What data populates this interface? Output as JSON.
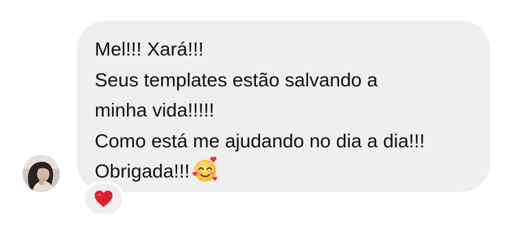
{
  "message": {
    "lines": [
      "Mel!!! Xará!!!",
      "Seus templates estão salvando a",
      "minha vida!!!!!",
      "Como está me ajudando no dia a dia!!!",
      "Obrigada!!!"
    ],
    "trailing_emoji": "smiling-face-with-hearts-icon"
  },
  "reaction": {
    "emoji": "red-heart-icon",
    "color": "#e0202f"
  },
  "colors": {
    "bubble": "#efefef",
    "text": "#111111",
    "background": "#ffffff"
  }
}
